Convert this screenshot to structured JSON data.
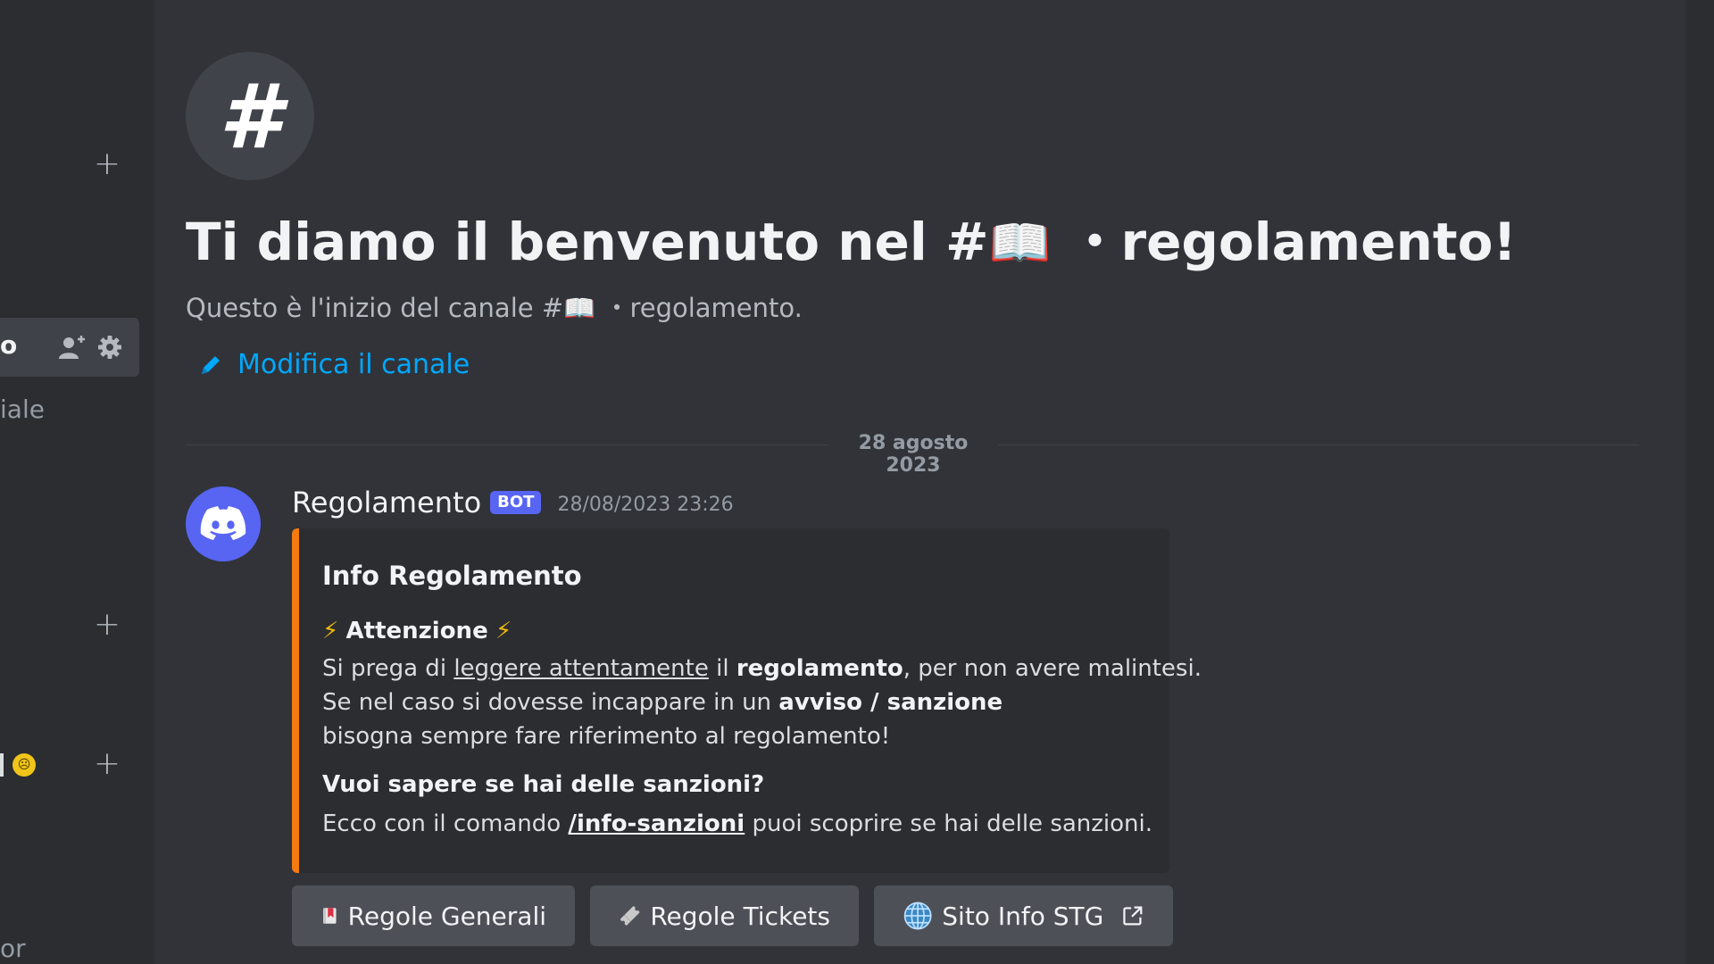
{
  "sidebar": {
    "active_item_label": "o",
    "text_item_1": "iale",
    "text_item_2": "or",
    "emoji_badge": "☹"
  },
  "channel": {
    "icon_glyph": "#",
    "welcome_prefix": "Ti diamo il benvenuto nel #",
    "welcome_emoji": "📖",
    "welcome_suffix": " ・regolamento!",
    "start_prefix": "Questo è l'inizio del canale #",
    "start_emoji": "📖",
    "start_suffix": " ・regolamento.",
    "edit_label": "Modifica il canale"
  },
  "divider": {
    "date": "28 agosto 2023"
  },
  "message": {
    "author": "Regolamento",
    "bot_tag": "BOT",
    "timestamp": "28/08/2023 23:26",
    "embed": {
      "color": "#f47b10",
      "title": "Info Regolamento",
      "attention_bolt_left": "⚡",
      "attention_text": "Attenzione",
      "attention_bolt_right": "⚡",
      "line1_a": "Si prega di ",
      "line1_link": "leggere attentamente",
      "line1_b": " il ",
      "line1_bold": "regolamento",
      "line1_c": ", per non avere malintesi.",
      "line2_a": "Se nel caso si dovesse incappare in un ",
      "line2_bold": "avviso / sanzione",
      "line3": "bisogna sempre fare riferimento al regolamento!",
      "question": "Vuoi sapere se hai delle sanzioni?",
      "line4_a": "Ecco con il comando ",
      "line4_cmd": "/info-sanzioni",
      "line4_b": " puoi scoprire se hai delle sanzioni."
    },
    "buttons": [
      {
        "label": "Regole Generali",
        "icon": "bookmark-icon"
      },
      {
        "label": "Regole Tickets",
        "icon": "ticket-icon"
      },
      {
        "label": "Sito Info STG",
        "icon": "globe-icon",
        "external": "external-link-icon"
      }
    ]
  },
  "colors": {
    "background": "#313338",
    "sidebar": "#2b2d31",
    "link": "#00a8fc",
    "blurple": "#5865f2",
    "embed_bg": "#2b2d31",
    "button_bg": "#4e5058"
  }
}
